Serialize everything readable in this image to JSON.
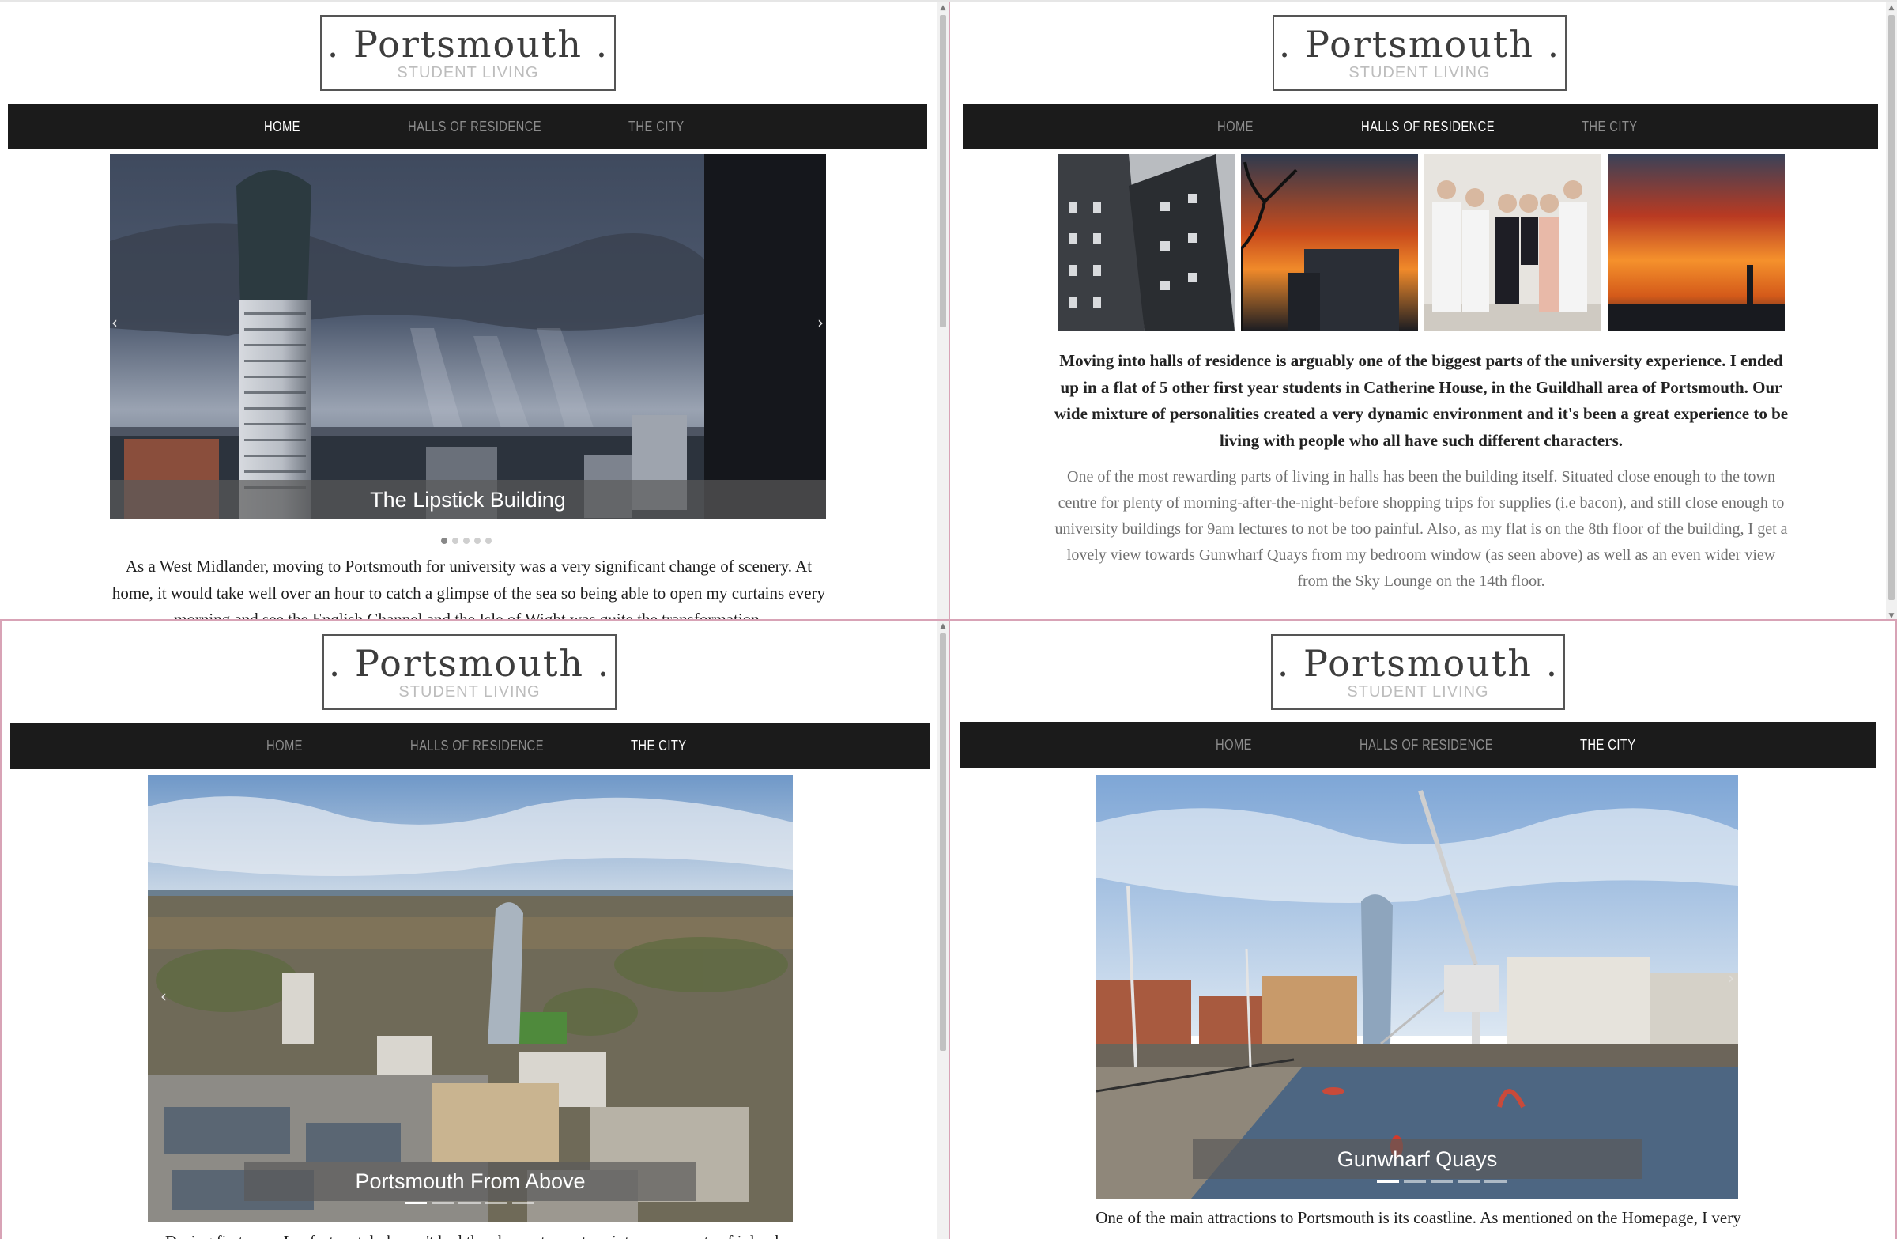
{
  "brand": {
    "title": ". Portsmouth .",
    "subtitle": "STUDENT LIVING"
  },
  "nav": {
    "home": "HOME",
    "halls": "HALLS OF RESIDENCE",
    "city": "THE CITY"
  },
  "colors": {
    "navbar": "#1b1b1b",
    "nav_inactive": "#8c8c8c",
    "nav_active": "#ffffff",
    "pane_divider": "#d8a3b6"
  },
  "icons": {
    "prev": "‹",
    "next": "›"
  },
  "home": {
    "carousel_caption": "The Lipstick Building",
    "carousel_slide_count": 5,
    "carousel_active_slide": 1,
    "paragraph": "As a West Midlander, moving to Portsmouth for university was a very significant change of scenery. At home, it would take well over an hour to catch a glimpse of the sea so being able to open my curtains every morning and see the English Channel and the Isle of Wight was quite the transformation."
  },
  "halls": {
    "paragraph_bold": "Moving into halls of residence is arguably one of the biggest parts of the university experience. I ended up in a flat of 5 other first year students in Catherine House, in the Guildhall area of Portsmouth. Our wide mixture of personalities created a very dynamic environment and it's been a great experience to be living with people who all have such different characters.",
    "paragraph_light": "One of the most rewarding parts of living in halls has been the building itself. Situated close enough to the town centre for plenty of morning-after-the-night-before shopping trips for supplies (i.e bacon), and still close enough to university buildings for 9am lectures to not be too painful. Also, as my flat is on the 8th floor of the building, I get a lovely view towards Gunwharf Quays from my bedroom window (as seen above) as well as an even wider view from the Sky Lounge on the 14th floor."
  },
  "city_a": {
    "carousel_caption": "Portsmouth From Above",
    "paragraph": "During first year, I unfortunately haven't had the chance to venture into many parts of inland"
  },
  "city_b": {
    "carousel_caption": "Gunwharf Quays",
    "paragraph": "One of the main attractions to Portsmouth is its coastline. As mentioned on the Homepage, I very"
  }
}
